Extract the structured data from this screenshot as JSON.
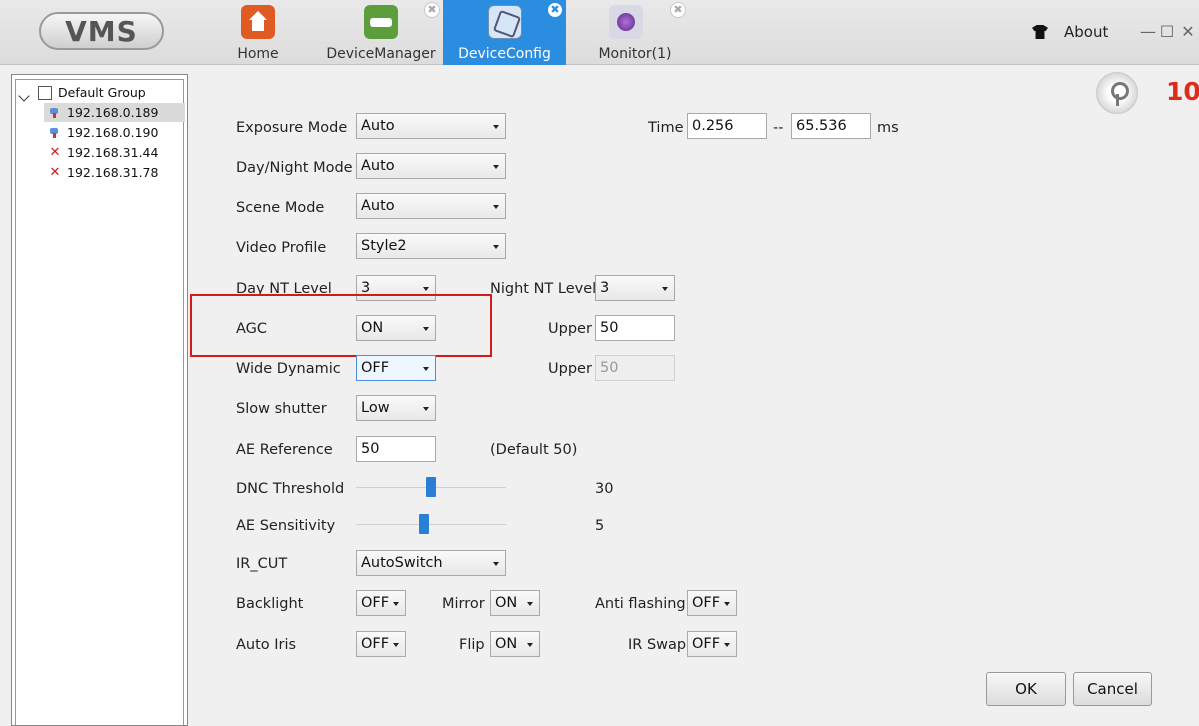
{
  "app": {
    "logo": "VMS"
  },
  "tabs": [
    {
      "label": "Home",
      "icon": "home-icon"
    },
    {
      "label": "DeviceManager",
      "icon": "device-manager-icon"
    },
    {
      "label": "DeviceConfig",
      "icon": "device-config-icon"
    },
    {
      "label": "Monitor(1)",
      "icon": "monitor-icon"
    }
  ],
  "header": {
    "about": "About",
    "minimize": "—",
    "maximize": "☐",
    "close": "✕",
    "close_tab": "✖"
  },
  "tree": {
    "group": "Default Group",
    "devices": [
      {
        "ip": "192.168.0.189",
        "status": "online"
      },
      {
        "ip": "192.168.0.190",
        "status": "online"
      },
      {
        "ip": "192.168.31.44",
        "status": "offline"
      },
      {
        "ip": "192.168.31.78",
        "status": "offline"
      }
    ],
    "offline_mark": "✕"
  },
  "counter": "10",
  "form": {
    "exposure_mode": {
      "label": "Exposure Mode",
      "value": "Auto"
    },
    "time": {
      "label": "Time",
      "min": "0.256",
      "sep": "--",
      "max": "65.536",
      "unit": "ms"
    },
    "day_night_mode": {
      "label": "Day/Night Mode",
      "value": "Auto"
    },
    "scene_mode": {
      "label": "Scene Mode",
      "value": "Auto"
    },
    "video_profile": {
      "label": "Video Profile",
      "value": "Style2"
    },
    "day_nt_level": {
      "label": "Day NT Level",
      "value": "3"
    },
    "night_nt_level": {
      "label": "Night NT Level",
      "value": "3"
    },
    "agc": {
      "label": "AGC",
      "value": "ON",
      "upper_label": "Upper",
      "upper_value": "50"
    },
    "wide_dynamic": {
      "label": "Wide Dynamic",
      "value": "OFF",
      "upper_label": "Upper",
      "upper_value": "50"
    },
    "slow_shutter": {
      "label": "Slow shutter",
      "value": "Low"
    },
    "ae_reference": {
      "label": "AE Reference",
      "value": "50",
      "hint": "(Default 50)"
    },
    "dnc_threshold": {
      "label": "DNC Threshold",
      "value": "30",
      "level": 0.5
    },
    "ae_sensitivity": {
      "label": "AE Sensitivity",
      "value": "5",
      "level": 0.45
    },
    "ir_cut": {
      "label": "IR_CUT",
      "value": "AutoSwitch"
    },
    "backlight": {
      "label": "Backlight",
      "value": "OFF"
    },
    "mirror": {
      "label": "Mirror",
      "value": "ON"
    },
    "anti_flashing": {
      "label": "Anti flashing",
      "value": "OFF"
    },
    "auto_iris": {
      "label": "Auto Iris",
      "value": "OFF"
    },
    "flip": {
      "label": "Flip",
      "value": "ON"
    },
    "ir_swap": {
      "label": "IR Swap",
      "value": "OFF"
    }
  },
  "buttons": {
    "ok": "OK",
    "cancel": "Cancel"
  },
  "colors": {
    "accent": "#2a8de0",
    "highlight": "#d11a1a",
    "counter": "#e02a1a"
  }
}
